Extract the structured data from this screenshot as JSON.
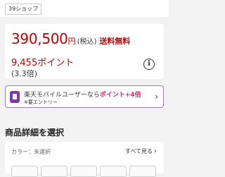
{
  "shop_tag": "39ショップ",
  "price": {
    "amount": "390,500",
    "unit": "円",
    "tax_label": "(税込)",
    "shipping": "送料無料",
    "points": "9,455ポイント",
    "points_rate": "(3.3倍)"
  },
  "info_icon": "info-icon",
  "promo": {
    "text_main": "楽天モバイルユーザーなら",
    "text_accent": "ポイント+4倍",
    "subtext": "※要エントリー",
    "chevron": "›"
  },
  "section_title": "商品詳細を選択",
  "variant": {
    "color_label": "カラー：未選択",
    "see_all": "すべて見る",
    "see_all_chevron": "›"
  },
  "colors": {
    "accent": "#bf0000",
    "promo_border": "#9b7ab0",
    "promo_accent": "#d6246e"
  }
}
